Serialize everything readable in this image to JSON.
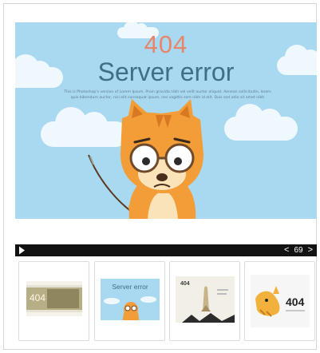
{
  "hero": {
    "code": "404",
    "title": "Server error",
    "body": "This is Photoshop's version of Lorem Ipsum. Proin gravida nibh vel velit auctor aliquet. Aenean sollicitudin, lorem quis bibendum auctor, nisi elit consequat ipsum, nec sagittis sem nibh id elit. Duis sed odio sit amet nibh",
    "colors": {
      "sky": "#a9d8f1",
      "code": "#e8866a",
      "title": "#3f6f88"
    }
  },
  "toolbar": {
    "play_icon": "play-icon",
    "prev": "<",
    "count": "69",
    "next": ">"
  },
  "thumbnails": [
    {
      "code": "404"
    },
    {
      "title": "Server error"
    },
    {
      "code": "404"
    },
    {
      "code": "404"
    }
  ]
}
